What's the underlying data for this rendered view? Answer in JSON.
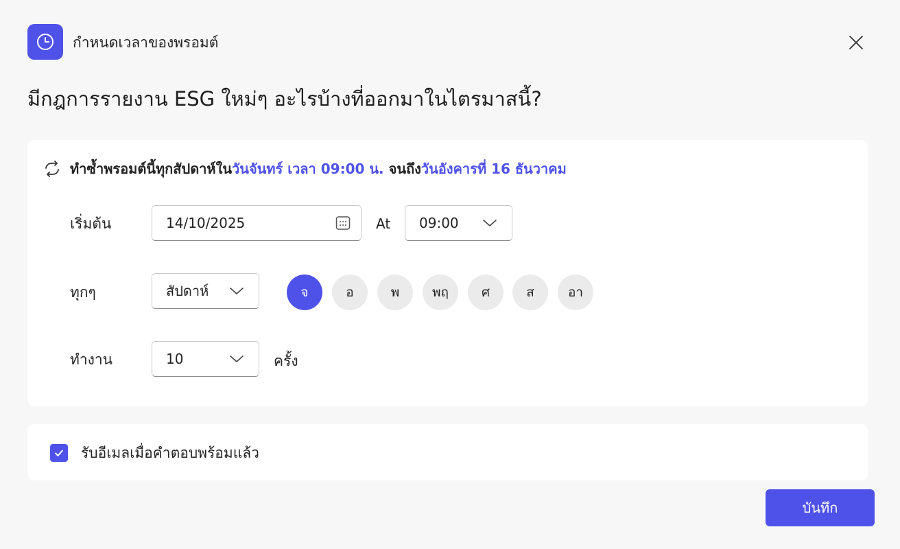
{
  "header": {
    "title": "กำหนดเวลาของพรอมต์",
    "icon": "clock-icon",
    "close_icon": "close-icon"
  },
  "prompt": {
    "title": "มีกฎการรายงาน ESG ใหม่ๆ อะไรบ้างที่ออกมาในไตรมาสนี้?"
  },
  "schedule": {
    "summary": {
      "prefix": "ทำซ้ำพรอมต์นี้ทุกสัปดาห์ใน",
      "day_time": "วันจันทร์ เวลา 09:00 น.",
      "middle": " จนถึง",
      "end_date": "วันอังคารที่ 16 ธันวาคม"
    },
    "start": {
      "label": "เริ่มต้น",
      "date": "14/10/2025",
      "at_label": "At",
      "time": "09:00"
    },
    "every": {
      "label": "ทุกๆ",
      "unit": "สัปดาห์",
      "days": [
        {
          "label": "จ",
          "active": true
        },
        {
          "label": "อ",
          "active": false
        },
        {
          "label": "พ",
          "active": false
        },
        {
          "label": "พฤ",
          "active": false
        },
        {
          "label": "ศ",
          "active": false
        },
        {
          "label": "ส",
          "active": false
        },
        {
          "label": "อา",
          "active": false
        }
      ]
    },
    "run": {
      "label": "ทำงาน",
      "count": "10",
      "suffix": "ครั้ง"
    }
  },
  "email": {
    "checked": true,
    "label": "รับอีเมลเมื่อคำตอบพร้อมแล้ว"
  },
  "actions": {
    "save_label": "บันทึก"
  },
  "colors": {
    "accent": "#4f52e8",
    "background": "#f7f7f7",
    "card": "#ffffff",
    "day_inactive": "#ebebeb"
  }
}
